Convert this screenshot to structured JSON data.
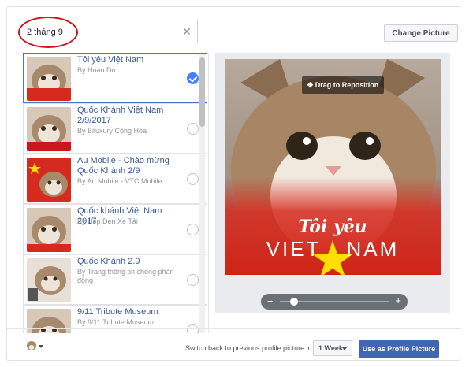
{
  "search": {
    "value": "2 tháng 9",
    "clear_icon": "close-icon"
  },
  "header": {
    "change_picture_label": "Change Picture"
  },
  "frames": [
    {
      "title": "Tôi yêu Việt Nam",
      "author": "By Hoan Do",
      "selected": true
    },
    {
      "title": "Quốc Khánh Việt Nam 2/9/2017",
      "author": "By Biluxury Cộng Hòa",
      "selected": false
    },
    {
      "title": "Au Mobile - Chào mừng Quốc Khánh 2/9",
      "author": "By Au Mobile - VTC Mobile",
      "selected": false
    },
    {
      "title": "Quốc khánh Việt Nam 2017",
      "author": "By Hộp Đen Xe Tải",
      "selected": false
    },
    {
      "title": "Quốc Khánh 2.9",
      "author": "By Trang thông tin chống phản động",
      "selected": false
    },
    {
      "title": "9/11 Tribute Museum",
      "author": "By 9/11 Tribute Museum",
      "selected": false
    }
  ],
  "preview": {
    "drag_label": "Drag to Reposition",
    "frame_text_top": "Tôi yêu",
    "frame_text_left": "VIET",
    "frame_text_right": "NAM",
    "zoom_out_symbol": "−",
    "zoom_in_symbol": "+",
    "zoom_level": 0.1
  },
  "footer": {
    "privacy_icon": "cat-thumbnail-icon",
    "switch_back_label": "Switch back to previous profile picture in",
    "duration_value": "1 Week",
    "use_button_label": "Use as Profile Picture"
  },
  "colors": {
    "accent": "#4267b2",
    "link": "#365899",
    "frame_red": "#d62a1e",
    "star_yellow": "#ffde00",
    "highlight_circle": "#d3121b"
  }
}
